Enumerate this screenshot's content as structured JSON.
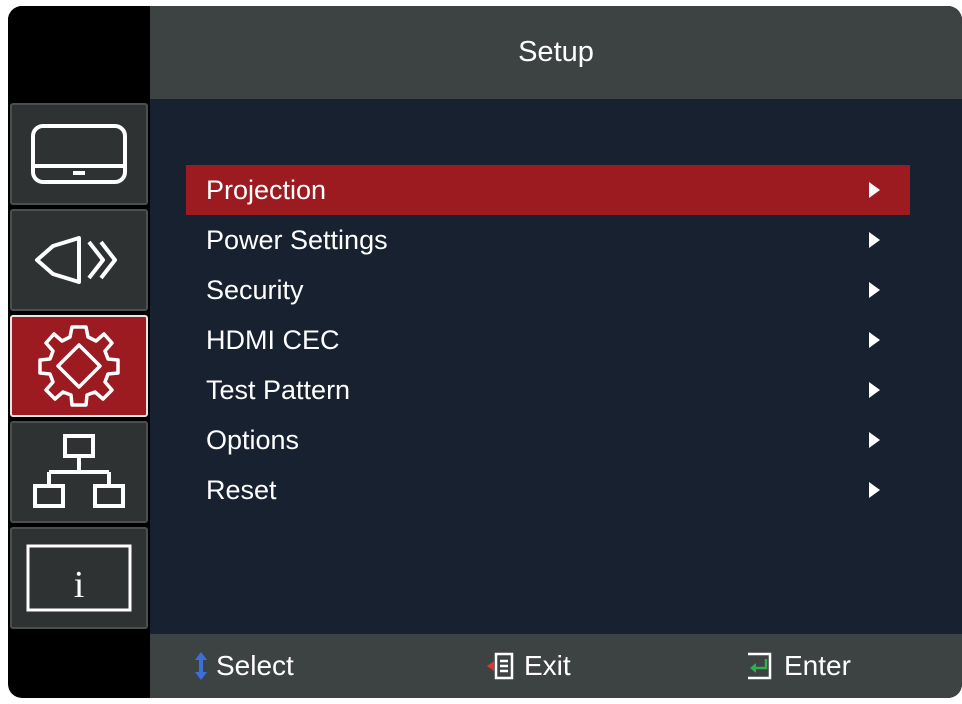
{
  "header": {
    "title": "Setup"
  },
  "sidebar": {
    "items": [
      {
        "icon": "display-icon",
        "active": false
      },
      {
        "icon": "projector-icon",
        "active": false
      },
      {
        "icon": "gear-icon",
        "active": true
      },
      {
        "icon": "network-icon",
        "active": false
      },
      {
        "icon": "info-icon",
        "active": false,
        "glyph": "i"
      }
    ]
  },
  "menu": {
    "items": [
      {
        "label": "Projection",
        "selected": true
      },
      {
        "label": "Power Settings",
        "selected": false
      },
      {
        "label": "Security",
        "selected": false
      },
      {
        "label": "HDMI CEC",
        "selected": false
      },
      {
        "label": "Test Pattern",
        "selected": false
      },
      {
        "label": "Options",
        "selected": false
      },
      {
        "label": "Reset",
        "selected": false
      }
    ]
  },
  "footer": {
    "select_label": "Select",
    "exit_label": "Exit",
    "enter_label": "Enter"
  },
  "colors": {
    "accent": "#9b1b21",
    "panel": "#172130",
    "bar": "#3d4243"
  }
}
